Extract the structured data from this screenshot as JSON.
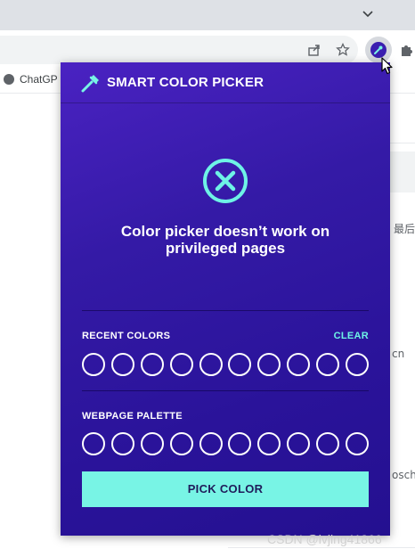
{
  "browser": {
    "bookmark_label": "ChatGP",
    "icons": [
      "chevron-down-icon",
      "share-icon",
      "star-icon",
      "color-picker-extension-icon",
      "puzzle-icon"
    ],
    "background_text": {
      "side_label": "最后",
      "fragment_cn": "cn",
      "fragment_osch": "osch"
    },
    "watermark": "CSDN @lvjing41866"
  },
  "popup": {
    "title": "SMART COLOR PICKER",
    "error_message": "Color picker doesn’t work on privileged pages",
    "recent": {
      "label": "RECENT COLORS",
      "clear_label": "CLEAR",
      "swatch_count": 10
    },
    "palette": {
      "label": "WEBPAGE PALETTE",
      "swatch_count": 10
    },
    "pick_button_label": "PICK COLOR",
    "colors": {
      "accent": "#78f4e5",
      "clear_link": "#6ef3e6",
      "background_start": "#4a22c2",
      "background_end": "#241090",
      "button_text": "#1f1b5a"
    }
  }
}
